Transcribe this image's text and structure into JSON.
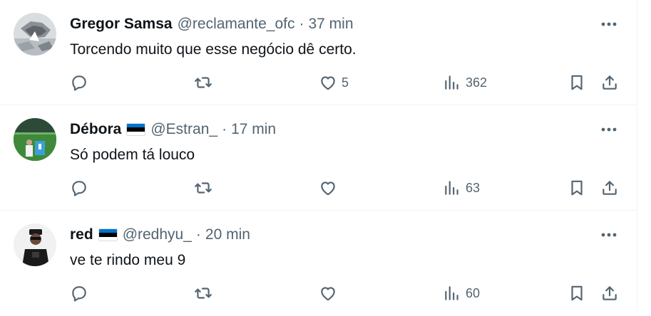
{
  "tweets": [
    {
      "name": "Gregor Samsa",
      "has_flag": false,
      "handle": "@reclamante_ofc",
      "separator": "·",
      "time": "37 min",
      "text": "Torcendo muito que esse negócio dê certo.",
      "likes": "5",
      "views": "362"
    },
    {
      "name": "Débora",
      "has_flag": true,
      "handle": "@Estran_",
      "separator": "·",
      "time": "17 min",
      "text": "Só podem tá louco",
      "likes": "",
      "views": "63"
    },
    {
      "name": "red",
      "has_flag": true,
      "handle": "@redhyu_",
      "separator": "·",
      "time": "20 min",
      "text": "ve te rindo meu 9",
      "likes": "",
      "views": "60"
    }
  ],
  "icons": {
    "reply": "reply-icon",
    "retweet": "retweet-icon",
    "like": "heart-icon",
    "views": "analytics-icon",
    "bookmark": "bookmark-icon",
    "share": "share-icon",
    "more": "more-icon",
    "flag": "estonia-flag-icon"
  },
  "colors": {
    "text": "#0f1419",
    "secondary": "#536471",
    "divider": "#eff3f4",
    "flag_blue": "#0072ce",
    "flag_black": "#000000",
    "flag_white": "#ffffff"
  }
}
